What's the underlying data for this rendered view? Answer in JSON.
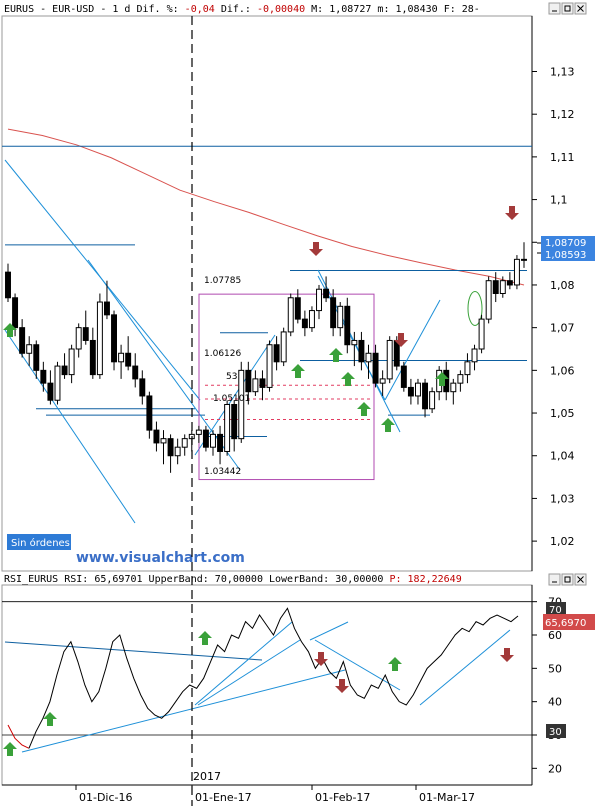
{
  "header": {
    "symbol": "EURUS",
    "instrument": "EUR-USD",
    "period": "1 d",
    "dif_pct_label": "Dif. %:",
    "dif_pct": "-0,04",
    "dif_label": "Dif.:",
    "dif": "-0,00040",
    "max_label": "M:",
    "max": "1,08727",
    "min_label": "m:",
    "min": "1,08430",
    "date_label": "F:",
    "date": "28-"
  },
  "rsi_header": {
    "name": "RSI_EURUS",
    "rsi_label": "RSI:",
    "rsi": "65,69701",
    "upper_label": "UpperBand:",
    "upper": "70,00000",
    "lower_label": "LowerBand:",
    "lower": "30,00000",
    "p_label": "P:",
    "p": "182,22649"
  },
  "badges": {
    "price_top": "1,08709",
    "price_last": "1,08593",
    "rsi_upper": "70",
    "rsi_value": "65,6970",
    "rsi_lower": "30"
  },
  "levels": {
    "fib_top": "1.07785",
    "fib_mid": "1.06126",
    "fib_53": "53",
    "fib_low": "1.05101",
    "fib_bottom": "1.03442"
  },
  "status": {
    "orders": "Sin órdenes"
  },
  "watermark": "www.visualchart.com",
  "year_marker": "2017",
  "colors": {
    "bull_candle": "#ffffff",
    "bear_candle": "#000000",
    "trendline": "#1e90d8",
    "support": "#0d5fa0",
    "moving_average": "#d9534f",
    "fib_box": "#b04ab0",
    "fib_dotted": "#e23b60",
    "arrow_up": "#3aa13a",
    "arrow_down": "#a33a3a",
    "badge_blue": "#3b84e0",
    "badge_red": "#d24a4a",
    "badge_dark": "#333333",
    "watermark": "#3b6fc7",
    "orders_bg": "#2e7bd6"
  },
  "chart_data": [
    {
      "type": "candlestick",
      "title": "EURUS - EUR-USD - 1 d",
      "x_ticks": [
        "01-Dic-16",
        "01-Ene-17",
        "01-Feb-17",
        "01-Mar-17"
      ],
      "y_ticks": [
        "1,02",
        "1,03",
        "1,04",
        "1,05",
        "1,06",
        "1,07",
        "1,08",
        "1,09",
        "1,1",
        "1,11",
        "1,12",
        "1,13"
      ],
      "ylim": [
        1.013,
        1.143
      ],
      "candles": [
        [
          1.083,
          1.085,
          1.076,
          1.077
        ],
        [
          1.077,
          1.078,
          1.068,
          1.07
        ],
        [
          1.07,
          1.072,
          1.063,
          1.064
        ],
        [
          1.064,
          1.068,
          1.061,
          1.066
        ],
        [
          1.066,
          1.067,
          1.058,
          1.06
        ],
        [
          1.06,
          1.062,
          1.055,
          1.057
        ],
        [
          1.057,
          1.06,
          1.052,
          1.053
        ],
        [
          1.053,
          1.062,
          1.052,
          1.061
        ],
        [
          1.061,
          1.064,
          1.058,
          1.059
        ],
        [
          1.059,
          1.066,
          1.057,
          1.065
        ],
        [
          1.065,
          1.071,
          1.063,
          1.07
        ],
        [
          1.07,
          1.074,
          1.066,
          1.067
        ],
        [
          1.067,
          1.07,
          1.058,
          1.059
        ],
        [
          1.059,
          1.078,
          1.058,
          1.076
        ],
        [
          1.076,
          1.081,
          1.072,
          1.073
        ],
        [
          1.073,
          1.074,
          1.06,
          1.062
        ],
        [
          1.062,
          1.066,
          1.058,
          1.064
        ],
        [
          1.064,
          1.068,
          1.06,
          1.061
        ],
        [
          1.061,
          1.064,
          1.056,
          1.058
        ],
        [
          1.058,
          1.06,
          1.052,
          1.054
        ],
        [
          1.054,
          1.055,
          1.044,
          1.046
        ],
        [
          1.046,
          1.048,
          1.041,
          1.043
        ],
        [
          1.043,
          1.046,
          1.038,
          1.044
        ],
        [
          1.044,
          1.045,
          1.036,
          1.04
        ],
        [
          1.04,
          1.044,
          1.038,
          1.042
        ],
        [
          1.042,
          1.045,
          1.04,
          1.044
        ],
        [
          1.044,
          1.046,
          1.041,
          1.045
        ],
        [
          1.045,
          1.047,
          1.043,
          1.046
        ],
        [
          1.046,
          1.047,
          1.041,
          1.042
        ],
        [
          1.042,
          1.046,
          1.04,
          1.045
        ],
        [
          1.045,
          1.047,
          1.038,
          1.041
        ],
        [
          1.041,
          1.053,
          1.04,
          1.052
        ],
        [
          1.052,
          1.053,
          1.041,
          1.044
        ],
        [
          1.044,
          1.062,
          1.043,
          1.06
        ],
        [
          1.06,
          1.062,
          1.052,
          1.055
        ],
        [
          1.055,
          1.06,
          1.054,
          1.058
        ],
        [
          1.058,
          1.06,
          1.053,
          1.056
        ],
        [
          1.056,
          1.067,
          1.055,
          1.066
        ],
        [
          1.066,
          1.068,
          1.06,
          1.062
        ],
        [
          1.062,
          1.07,
          1.061,
          1.069
        ],
        [
          1.069,
          1.078,
          1.068,
          1.077
        ],
        [
          1.077,
          1.079,
          1.071,
          1.072
        ],
        [
          1.072,
          1.074,
          1.068,
          1.07
        ],
        [
          1.07,
          1.075,
          1.069,
          1.074
        ],
        [
          1.074,
          1.08,
          1.072,
          1.079
        ],
        [
          1.079,
          1.082,
          1.076,
          1.077
        ],
        [
          1.077,
          1.079,
          1.068,
          1.07
        ],
        [
          1.07,
          1.076,
          1.068,
          1.075
        ],
        [
          1.075,
          1.077,
          1.064,
          1.066
        ],
        [
          1.066,
          1.069,
          1.061,
          1.067
        ],
        [
          1.067,
          1.069,
          1.06,
          1.062
        ],
        [
          1.062,
          1.066,
          1.058,
          1.064
        ],
        [
          1.064,
          1.066,
          1.056,
          1.057
        ],
        [
          1.057,
          1.06,
          1.054,
          1.058
        ],
        [
          1.058,
          1.068,
          1.057,
          1.067
        ],
        [
          1.067,
          1.068,
          1.06,
          1.061
        ],
        [
          1.061,
          1.062,
          1.055,
          1.056
        ],
        [
          1.056,
          1.058,
          1.052,
          1.054
        ],
        [
          1.054,
          1.058,
          1.052,
          1.057
        ],
        [
          1.057,
          1.058,
          1.049,
          1.051
        ],
        [
          1.051,
          1.056,
          1.05,
          1.055
        ],
        [
          1.055,
          1.061,
          1.053,
          1.06
        ],
        [
          1.06,
          1.062,
          1.053,
          1.055
        ],
        [
          1.055,
          1.058,
          1.052,
          1.057
        ],
        [
          1.057,
          1.06,
          1.055,
          1.059
        ],
        [
          1.059,
          1.064,
          1.057,
          1.062
        ],
        [
          1.062,
          1.066,
          1.06,
          1.065
        ],
        [
          1.065,
          1.073,
          1.064,
          1.072
        ],
        [
          1.072,
          1.082,
          1.071,
          1.081
        ],
        [
          1.081,
          1.083,
          1.076,
          1.078
        ],
        [
          1.078,
          1.082,
          1.077,
          1.081
        ],
        [
          1.081,
          1.083,
          1.079,
          1.08
        ],
        [
          1.08,
          1.087,
          1.079,
          1.086
        ],
        [
          1.086,
          1.09,
          1.084,
          1.0859
        ]
      ],
      "moving_average": [
        [
          0,
          1.1165
        ],
        [
          20,
          1.115
        ],
        [
          40,
          1.1128
        ],
        [
          60,
          1.1098
        ],
        [
          80,
          1.106
        ],
        [
          100,
          1.1022
        ],
        [
          120,
          1.0995
        ],
        [
          140,
          1.097
        ],
        [
          160,
          1.0942
        ],
        [
          180,
          1.0915
        ],
        [
          200,
          1.089
        ],
        [
          220,
          1.087
        ],
        [
          240,
          1.0852
        ],
        [
          260,
          1.0835
        ],
        [
          280,
          1.082
        ],
        [
          300,
          1.08
        ]
      ]
    },
    {
      "type": "line",
      "title": "RSI_EURUS",
      "y_ticks": [
        "20",
        "30",
        "40",
        "50",
        "60",
        "70"
      ],
      "ylim": [
        15,
        75
      ],
      "bands": [
        30,
        70
      ],
      "values": [
        33,
        29,
        27,
        26,
        31,
        35,
        40,
        48,
        55,
        58,
        52,
        45,
        40,
        43,
        50,
        58,
        60,
        53,
        47,
        42,
        38,
        36,
        35,
        37,
        40,
        43,
        45,
        44,
        47,
        52,
        57,
        55,
        60,
        59,
        64,
        62,
        66,
        63,
        60,
        65,
        68,
        62,
        58,
        55,
        50,
        53,
        49,
        47,
        52,
        45,
        42,
        41,
        45,
        44,
        48,
        43,
        40,
        39,
        42,
        46,
        50,
        52,
        54,
        57,
        60,
        62,
        61,
        64,
        63,
        65,
        66,
        65,
        64,
        65.7
      ]
    }
  ]
}
